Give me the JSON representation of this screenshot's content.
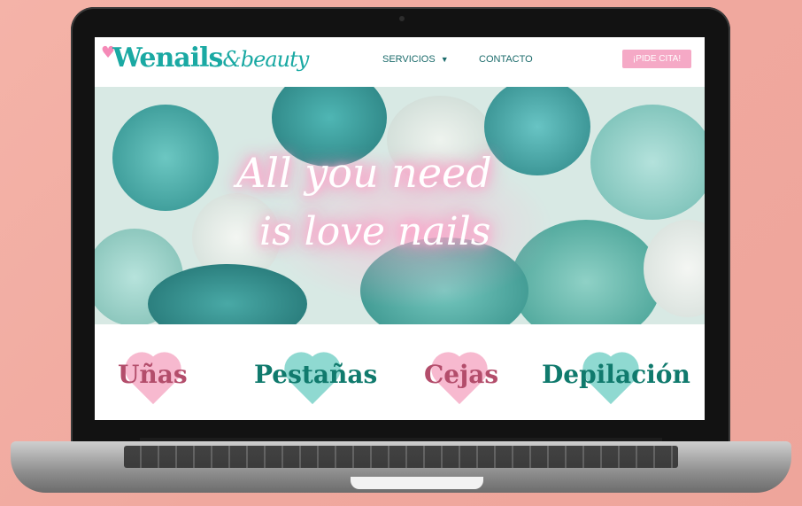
{
  "header": {
    "logo_main": "Wenails",
    "logo_script": "&beauty",
    "nav_servicios": "SERVICIOS",
    "nav_contacto": "CONTACTO",
    "cta_label": "¡PIDE CITA!"
  },
  "hero": {
    "line1": "All you need",
    "line2": "is love nails"
  },
  "categories": [
    {
      "label": "Uñas"
    },
    {
      "label": "Pestañas"
    },
    {
      "label": "Cejas"
    },
    {
      "label": "Depilación"
    }
  ],
  "colors": {
    "background": "#f0a89e",
    "brand_teal": "#1aa9a3",
    "brand_pink": "#f5a9c6",
    "category_rose": "#b34d6b",
    "category_green": "#107a6d"
  },
  "icons": {
    "logo_heart": "heart-icon",
    "servicios_chevron": "chevron-down-icon"
  }
}
